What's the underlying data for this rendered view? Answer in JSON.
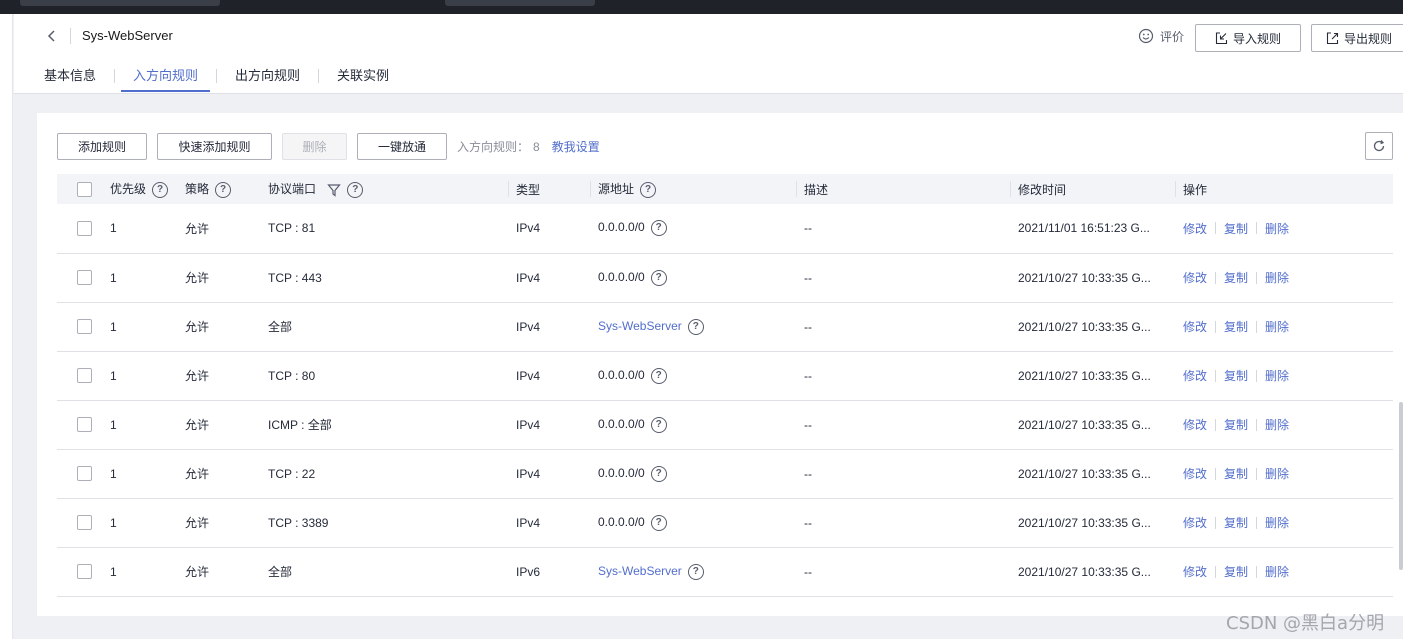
{
  "header": {
    "title": "Sys-WebServer",
    "rate_label": "评价",
    "import_label": "导入规则",
    "export_label": "导出规则"
  },
  "tabs": [
    {
      "label": "基本信息",
      "active": false
    },
    {
      "label": "入方向规则",
      "active": true
    },
    {
      "label": "出方向规则",
      "active": false
    },
    {
      "label": "关联实例",
      "active": false
    }
  ],
  "toolbar": {
    "add_rule": "添加规则",
    "quick_add": "快速添加规则",
    "delete": "删除",
    "one_click": "一键放通",
    "rule_count_label": "入方向规则：",
    "rule_count": "8",
    "help_link": "教我设置"
  },
  "columns": {
    "priority": "优先级",
    "policy": "策略",
    "protocol_port": "协议端口",
    "type": "类型",
    "source": "源地址",
    "description": "描述",
    "modified": "修改时间",
    "actions": "操作"
  },
  "row_actions": {
    "edit": "修改",
    "copy": "复制",
    "delete": "删除"
  },
  "rows": [
    {
      "priority": "1",
      "policy": "允许",
      "protocol_port": "TCP : 81",
      "type": "IPv4",
      "source": "0.0.0.0/0",
      "source_is_link": false,
      "description": "--",
      "modified": "2021/11/01 16:51:23 G..."
    },
    {
      "priority": "1",
      "policy": "允许",
      "protocol_port": "TCP : 443",
      "type": "IPv4",
      "source": "0.0.0.0/0",
      "source_is_link": false,
      "description": "--",
      "modified": "2021/10/27 10:33:35 G..."
    },
    {
      "priority": "1",
      "policy": "允许",
      "protocol_port": "全部",
      "type": "IPv4",
      "source": "Sys-WebServer",
      "source_is_link": true,
      "description": "--",
      "modified": "2021/10/27 10:33:35 G..."
    },
    {
      "priority": "1",
      "policy": "允许",
      "protocol_port": "TCP : 80",
      "type": "IPv4",
      "source": "0.0.0.0/0",
      "source_is_link": false,
      "description": "--",
      "modified": "2021/10/27 10:33:35 G..."
    },
    {
      "priority": "1",
      "policy": "允许",
      "protocol_port": "ICMP : 全部",
      "type": "IPv4",
      "source": "0.0.0.0/0",
      "source_is_link": false,
      "description": "--",
      "modified": "2021/10/27 10:33:35 G..."
    },
    {
      "priority": "1",
      "policy": "允许",
      "protocol_port": "TCP : 22",
      "type": "IPv4",
      "source": "0.0.0.0/0",
      "source_is_link": false,
      "description": "--",
      "modified": "2021/10/27 10:33:35 G..."
    },
    {
      "priority": "1",
      "policy": "允许",
      "protocol_port": "TCP : 3389",
      "type": "IPv4",
      "source": "0.0.0.0/0",
      "source_is_link": false,
      "description": "--",
      "modified": "2021/10/27 10:33:35 G..."
    },
    {
      "priority": "1",
      "policy": "允许",
      "protocol_port": "全部",
      "type": "IPv6",
      "source": "Sys-WebServer",
      "source_is_link": true,
      "description": "--",
      "modified": "2021/10/27 10:33:35 G..."
    }
  ],
  "watermark": "CSDN @黑白a分明",
  "colors": {
    "accent": "#526ecc",
    "border": "#adb0b8",
    "header_bg": "#f3f4f7"
  },
  "icons": {
    "back": "chevron-left-icon",
    "rate": "smiley-icon",
    "import": "import-icon",
    "export": "export-icon",
    "refresh": "refresh-icon",
    "help": "question-circle-icon",
    "filter": "filter-icon"
  }
}
